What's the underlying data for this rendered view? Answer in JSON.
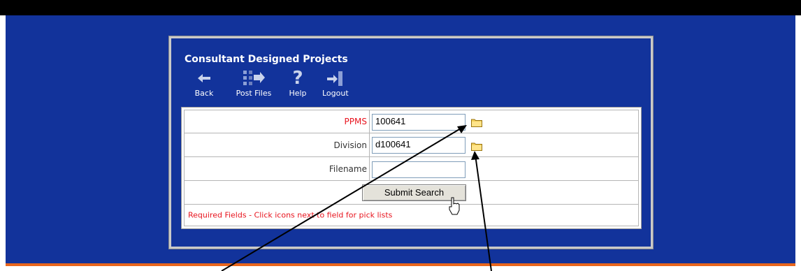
{
  "panel": {
    "title": "Consultant Designed Projects"
  },
  "toolbar": [
    {
      "label": "Back",
      "icon": "back-arrow-icon"
    },
    {
      "label": "Post Files",
      "icon": "post-files-icon"
    },
    {
      "label": "Help",
      "icon": "help-question-icon"
    },
    {
      "label": "Logout",
      "icon": "logout-door-icon"
    }
  ],
  "form": {
    "ppms": {
      "label": "PPMS",
      "value": "100641",
      "label_color": "#e8141e"
    },
    "division": {
      "label": "Division",
      "value": "d100641"
    },
    "filename": {
      "label": "Filename",
      "value": ""
    },
    "submit_label": "Submit Search",
    "required_note": "Required Fields - Click icons next to field for pick lists"
  },
  "colors": {
    "background": "#12339b",
    "top_bar": "#000000",
    "accent_line": "#e8661c",
    "required": "#e8141e"
  }
}
